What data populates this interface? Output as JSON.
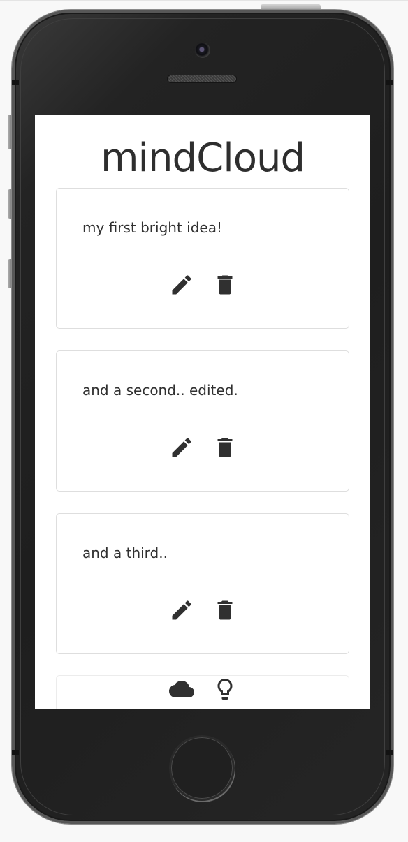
{
  "app": {
    "title": "mindCloud"
  },
  "ideas": [
    {
      "text": "my first bright idea!",
      "actions": [
        "pencil-icon",
        "trash-icon"
      ]
    },
    {
      "text": "and a second.. edited.",
      "actions": [
        "pencil-icon",
        "trash-icon"
      ]
    },
    {
      "text": "and a third..",
      "actions": [
        "pencil-icon",
        "trash-icon"
      ]
    }
  ],
  "composer": {
    "icons": [
      "cloud-icon",
      "lightbulb-icon"
    ]
  },
  "colors": {
    "icon": "#303030",
    "text": "#303030",
    "card_border": "#dedede",
    "screen_background": "#ffffff",
    "device_body": "#222222"
  }
}
